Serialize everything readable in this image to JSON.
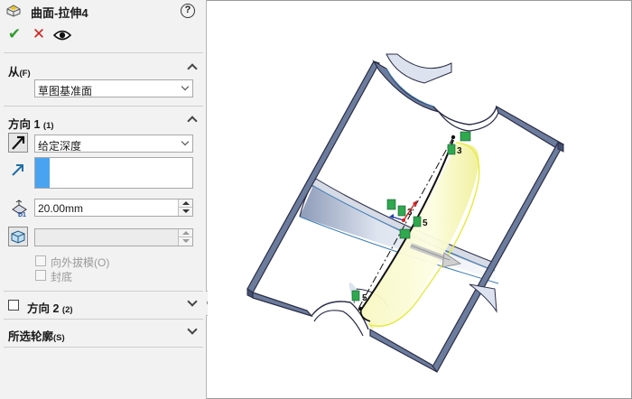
{
  "feature": {
    "title": "曲面-拉伸4",
    "icon": "surface-extrude-icon",
    "help": "?"
  },
  "actions": {
    "ok": "✔",
    "cancel": "✕",
    "preview": "eye-icon"
  },
  "from": {
    "label": "从",
    "shortcut": "(F)",
    "value": "草图基准面"
  },
  "direction1": {
    "label": "方向 1",
    "shortcut": "(1)",
    "end_condition": "给定深度",
    "depth": "20.00mm",
    "draft_outward_label": "向外拔模",
    "draft_outward_shortcut": "(O)",
    "cap_end_label": "封底",
    "draft_outward_checked": false,
    "cap_end_checked": false
  },
  "direction2": {
    "label": "方向 2",
    "shortcut": "(2)",
    "checked": false
  },
  "selected_contours": {
    "label": "所选轮廓",
    "shortcut": "(S)"
  },
  "viewport": {
    "tags": [
      "3",
      "3",
      "5",
      "5"
    ],
    "colors": {
      "body_edge": "#2b2d48",
      "body_face": "#6c7c9c",
      "preview_fill": "#fbfbd0",
      "preview_edge": "#e6ea3c",
      "relation_green": "#2fa84f"
    }
  }
}
